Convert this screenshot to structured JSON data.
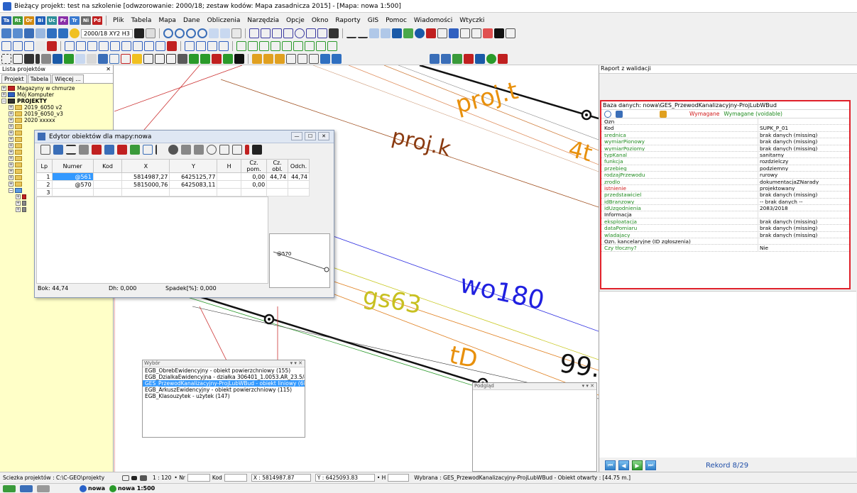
{
  "titlebar": {
    "title": "Bieżący projekt: test na szkolenie [odwzorowanie: 2000/18; zestaw kodów: Mapa zasadnicza 2015] - [Mapa: nowa  1:500]"
  },
  "menu": {
    "layers": [
      "Ta",
      "Rt",
      "Or",
      "Bi",
      "Uc",
      "Pr",
      "Tr",
      "Ni",
      "Pd"
    ],
    "layer_colors": [
      "#2d61b8",
      "#3c9a3c",
      "#d28a10",
      "#1f5eb8",
      "#2f8f9a",
      "#8a2fa8",
      "#3a7ad0",
      "#6a6a6a",
      "#c02020"
    ],
    "items": [
      "Plik",
      "Tabela",
      "Mapa",
      "Dane",
      "Obliczenia",
      "Narzędzia",
      "Opcje",
      "Okno",
      "Raporty",
      "GIS",
      "Pomoc",
      "Wiadomości",
      "Wtyczki"
    ]
  },
  "toolbar": {
    "coord_system": "2000/18 XY2 H3"
  },
  "left_panel": {
    "title": "Lista projektów",
    "tabs": [
      "Projekt",
      "Tabela",
      "Więcej ..."
    ],
    "tree": [
      {
        "label": "Magazyny w chmurze",
        "level": 0
      },
      {
        "label": "Mój Komputer",
        "level": 0
      },
      {
        "label": "PROJEKTY",
        "level": 0
      },
      {
        "label": "2019_6050 v2",
        "level": 1
      },
      {
        "label": "2019_6050_v3",
        "level": 1
      },
      {
        "label": "2020 xxxxx",
        "level": 1
      }
    ]
  },
  "map": {
    "labels": {
      "proj_t": "proj.t",
      "proj_k": "proj.k",
      "fourt": "4t",
      "wo180": "wo180",
      "gs63": "gs63",
      "tD": "tD",
      "n99": "99."
    }
  },
  "editor": {
    "title": "Edytor obiektów dla mapy:nowa",
    "columns": [
      "Lp",
      "Numer",
      "Kod",
      "X",
      "Y",
      "H",
      "Cz. pom.",
      "Cz. obl.",
      "Odch."
    ],
    "rows": [
      {
        "lp": "1",
        "numer": "@561",
        "kod": "",
        "x": "5814987,27",
        "y": "6425125,77",
        "h": "",
        "czpom": "0,00",
        "czobl": "44,74",
        "odch": "44,74"
      },
      {
        "lp": "2",
        "numer": "@570",
        "kod": "",
        "x": "5815000,76",
        "y": "6425083,11",
        "h": "",
        "czpom": "0,00",
        "czobl": "",
        "odch": ""
      },
      {
        "lp": "3",
        "numer": "",
        "kod": "",
        "x": "",
        "y": "",
        "h": "",
        "czpom": "",
        "czobl": "",
        "odch": ""
      }
    ],
    "preview_label": "@570",
    "status": {
      "bok": "Bok: 44,74",
      "dh": "Dh: 0,000",
      "spadek": "Spadek[%]: 0,000"
    }
  },
  "wybor": {
    "title": "Wybór",
    "items": [
      "EGB_ObrebEwidencyjny - obiekt powierzchniowy (155)",
      "EGB_DzialkaEwidencyjna - działka 306401_1.0053.AR_23.5/4",
      "GES_PrzewodKanalizacyjny-ProjLubWBud - obiekt liniowy (68)",
      "EGB_ArkuszEwidencyjny - obiekt powierzchniowy (115)",
      "EGB_Klasouzytek - użytek (147)"
    ],
    "selected_index": 2
  },
  "podglad": {
    "title": "Podgląd"
  },
  "right_panel": {
    "title": "Raport z walidacji",
    "db_line": "Baza danych: nowa\\GES_PrzewodKanalizacyjny-ProjLubWBud",
    "legend_required": "Wymagane",
    "legend_voidable": "Wymagane (voidable)",
    "rows": [
      {
        "key": "Ozn",
        "value": "",
        "color": "black"
      },
      {
        "key": "Kod",
        "value": "SUPK_P_01",
        "color": "black"
      },
      {
        "key": "srednica",
        "value": "brak danych (missing)",
        "color": "green"
      },
      {
        "key": "wymiarPionowy",
        "value": "brak danych (missing)",
        "color": "green"
      },
      {
        "key": "wymiarPoziomy",
        "value": "brak danych (missing)",
        "color": "green"
      },
      {
        "key": "typKanal",
        "value": "sanitarny",
        "color": "green"
      },
      {
        "key": "funkcja",
        "value": "rozdzielczy",
        "color": "green"
      },
      {
        "key": "przebieg",
        "value": "podziemny",
        "color": "green"
      },
      {
        "key": "rodzajPrzewodu",
        "value": "rurowy",
        "color": "green"
      },
      {
        "key": "zrodlo",
        "value": "dokumentacjaZNarady",
        "color": "green"
      },
      {
        "key": "istnienie",
        "value": "projektowany",
        "color": "red"
      },
      {
        "key": "przedstawiciel",
        "value": "brak danych (missing)",
        "color": "green"
      },
      {
        "key": "idBranzowy",
        "value": "-- brak danych --",
        "color": "green"
      },
      {
        "key": "idUzgodnienia",
        "value": "2083/2018",
        "color": "green"
      },
      {
        "key": "Informacja",
        "value": "",
        "color": "black"
      },
      {
        "key": "eksploatacja",
        "value": "brak danych (missing)",
        "color": "green"
      },
      {
        "key": "dataPomiaru",
        "value": "brak danych (missing)",
        "color": "green"
      },
      {
        "key": "wladajacy",
        "value": "brak danych (missing)",
        "color": "green"
      },
      {
        "key": "Ozn. kancelaryjne (ID zgłoszenia)",
        "value": "",
        "color": "black"
      },
      {
        "key": "Czy tłoczny?",
        "value": "Nie",
        "color": "green"
      }
    ],
    "record": "Rekord 8/29"
  },
  "statusbar": {
    "path": "Sciezka projektów : C:\\C-GEO\\projekty",
    "scale": "1 : 120",
    "nr_label": "• Nr",
    "kod_label": "Kod",
    "x": "X : 5814987.87",
    "y": "Y : 6425093.83",
    "h_label": "• H",
    "selected": "Wybrana : GES_PrzewodKanalizacyjny-ProjLubWBud -  Obiekt otwarty : [44.75 m.]"
  },
  "taskbar": {
    "tab1": "nowa",
    "tab2": "nowa  1:500"
  }
}
